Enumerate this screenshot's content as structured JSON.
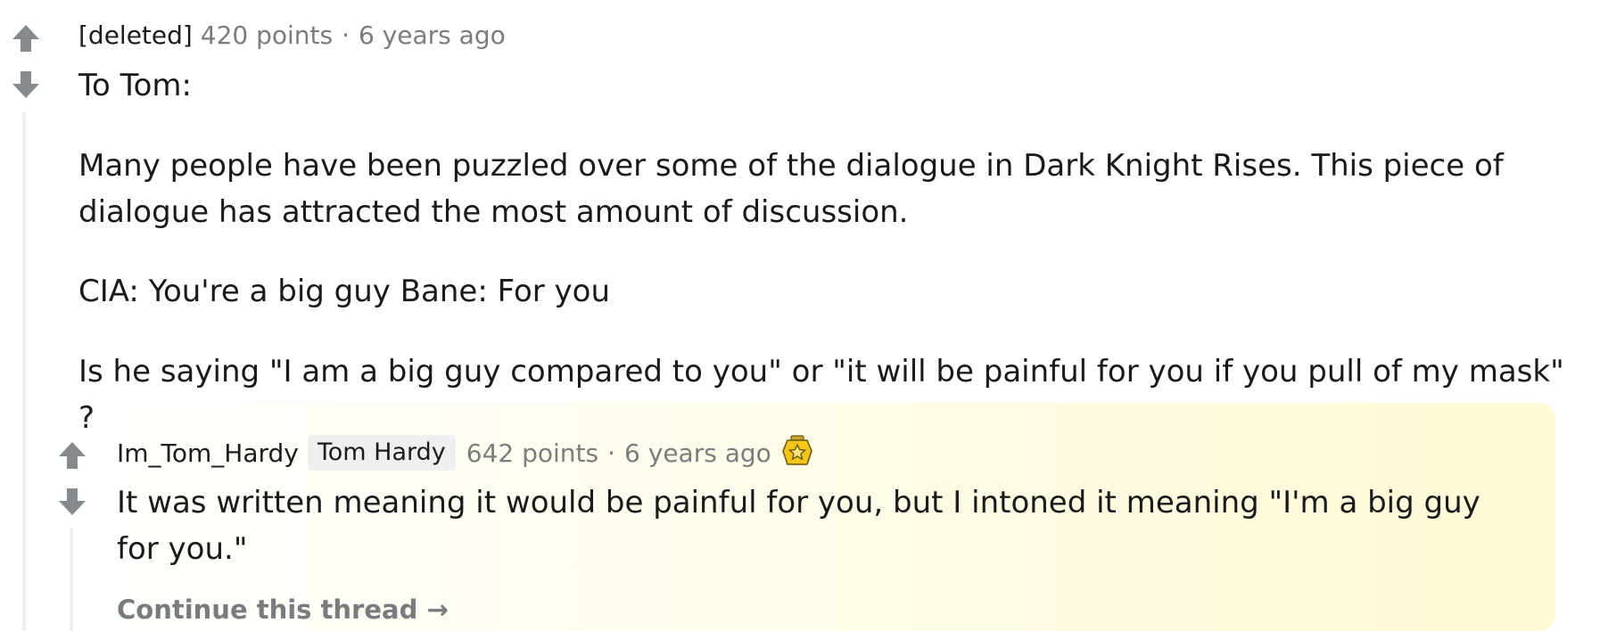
{
  "comment": {
    "author": "[deleted]",
    "points": "420 points",
    "separator": "·",
    "time": "6 years ago",
    "paragraphs": [
      "To Tom:",
      "Many people have been puzzled over some of the dialogue in Dark Knight Rises. This piece of dialogue has attracted the most amount of discussion.",
      "CIA: You're a big guy Bane: For you",
      "Is he saying \"I am a big guy compared to you\" or \"it will be painful for you if you pull of my mask\" ?"
    ]
  },
  "reply": {
    "author": "Im_Tom_Hardy",
    "flair": "Tom Hardy",
    "points": "642 points",
    "separator": "·",
    "time": "6 years ago",
    "award_icon": "gold-award-icon",
    "text": "It was written meaning it would be painful for you, but I intoned it meaning \"I'm a big guy for you.\"",
    "continue_label": "Continue this thread",
    "continue_arrow": "→"
  },
  "icons": {
    "upvote": "upvote-arrow-icon",
    "downvote": "downvote-arrow-icon"
  },
  "colors": {
    "vote_arrow": "#878a8c",
    "meta_text": "#7c7c7c",
    "body_text": "#1a1a1b",
    "flair_bg": "#edeff1",
    "thread_line": "#edeff1",
    "highlight": "#fff9c8",
    "award_gold": "#f5c518"
  }
}
